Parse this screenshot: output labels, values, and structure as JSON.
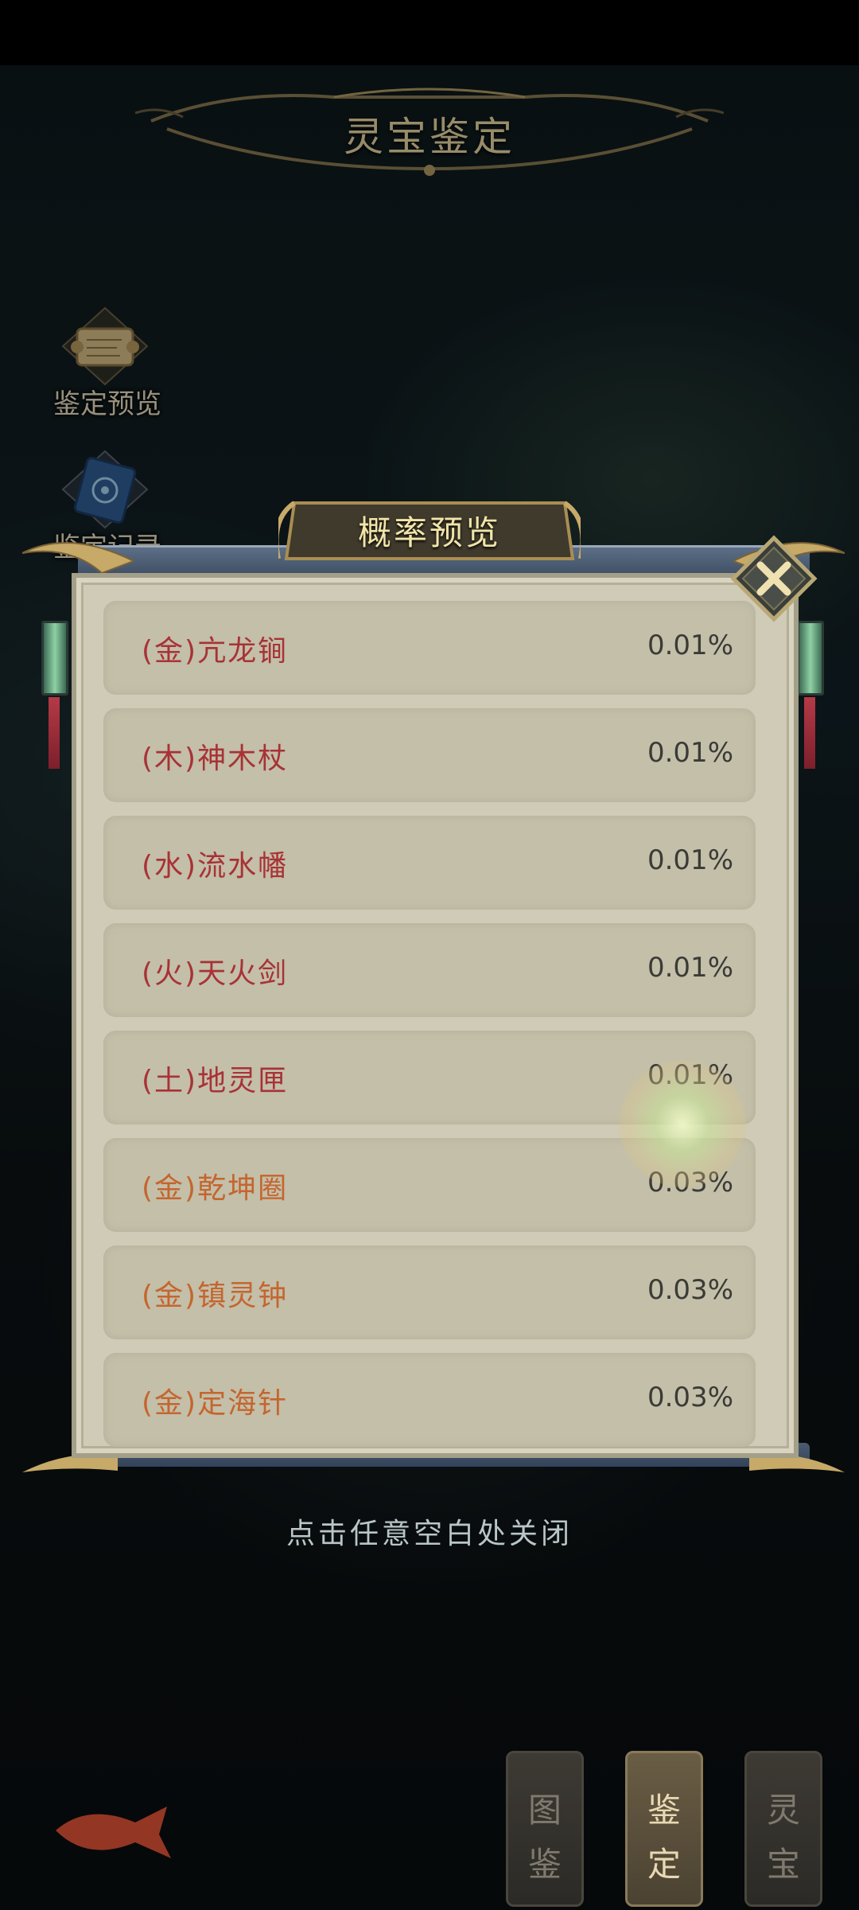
{
  "header": {
    "title": "灵宝鉴定"
  },
  "side_menu": [
    {
      "label": "鉴定预览",
      "icon": "scroll-icon"
    },
    {
      "label": "鉴定记录",
      "icon": "book-icon"
    }
  ],
  "modal": {
    "title": "概率预览",
    "close_icon": "close-icon",
    "items": [
      {
        "name": "(金)亢龙锏",
        "probability": "0.01%",
        "color": "#a83236"
      },
      {
        "name": "(木)神木杖",
        "probability": "0.01%",
        "color": "#a83236"
      },
      {
        "name": "(水)流水幡",
        "probability": "0.01%",
        "color": "#a83236"
      },
      {
        "name": "(火)天火剑",
        "probability": "0.01%",
        "color": "#a83236"
      },
      {
        "name": "(土)地灵匣",
        "probability": "0.01%",
        "color": "#a83236"
      },
      {
        "name": "(金)乾坤圈",
        "probability": "0.03%",
        "color": "#c5652e"
      },
      {
        "name": "(金)镇灵钟",
        "probability": "0.03%",
        "color": "#c5652e"
      },
      {
        "name": "(金)定海针",
        "probability": "0.03%",
        "color": "#c5652e"
      }
    ],
    "hint": "点击任意空白处关闭"
  },
  "bottom_tabs": [
    {
      "line1": "图",
      "line2": "鉴",
      "active": false
    },
    {
      "line1": "鉴",
      "line2": "定",
      "active": true
    },
    {
      "line1": "灵",
      "line2": "宝",
      "active": false
    }
  ]
}
